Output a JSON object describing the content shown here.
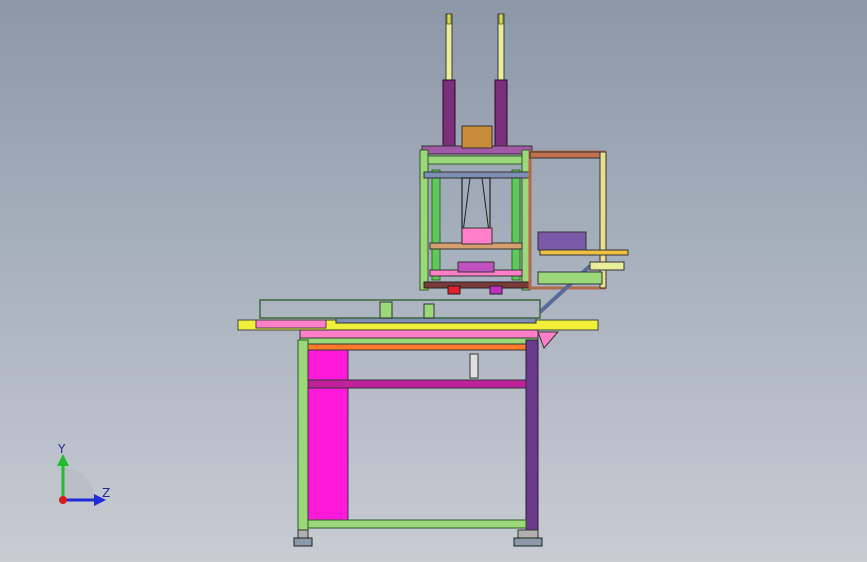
{
  "triad": {
    "y_label": "Y",
    "z_label": "Z",
    "colors": {
      "y": "#1fbf2a",
      "z": "#1e2bd6",
      "x": "#d81b1b"
    }
  },
  "colors": {
    "frame_green": "#9bd87a",
    "frame_green_dark": "#4f8a3a",
    "magenta": "#ff1ad9",
    "purple": "#7a3a9a",
    "orange": "#ff7a2a",
    "yellow": "#f0f03a",
    "blue_gray": "#7e8fb5",
    "pink": "#ff80c8"
  }
}
